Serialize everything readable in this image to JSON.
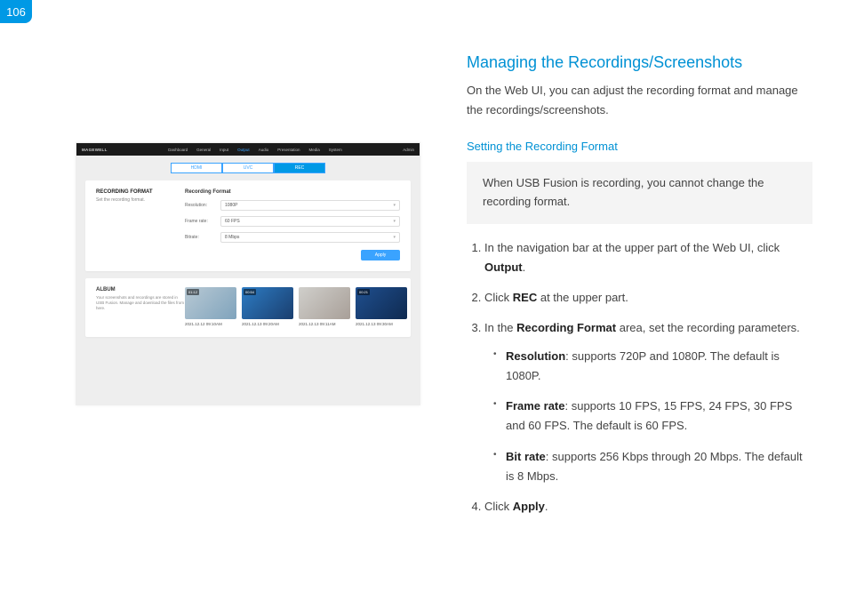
{
  "page_number": "106",
  "heading": "Managing the Recordings/Screenshots",
  "intro": "On the Web UI, you can adjust the recording format and manage the recordings/screenshots.",
  "subheading": "Setting the Recording Format",
  "note": "When USB Fusion is recording, you cannot change the recording format.",
  "steps": {
    "s1_a": "In the navigation bar at the upper part of the Web UI, click ",
    "s1_b": "Output",
    "s1_c": ".",
    "s2_a": "Click ",
    "s2_b": "REC",
    "s2_c": " at the upper part.",
    "s3_a": "In the ",
    "s3_b": "Recording Format",
    "s3_c": " area, set the recording parameters.",
    "s3_res_b": "Resolution",
    "s3_res_t": ": supports 720P and 1080P. The default is 1080P.",
    "s3_fr_b": "Frame rate",
    "s3_fr_t": ": supports 10 FPS, 15 FPS, 24 FPS, 30 FPS and 60 FPS. The default is 60 FPS.",
    "s3_br_b": "Bit rate",
    "s3_br_t": ": supports 256 Kbps through 20 Mbps. The default is 8 Mbps.",
    "s4_a": "Click ",
    "s4_b": "Apply",
    "s4_c": "."
  },
  "shot": {
    "brand": "MAGEWELL",
    "nav": [
      "Dashboard",
      "General",
      "Input",
      "Output",
      "Audio",
      "Presentation",
      "Media",
      "System"
    ],
    "admin": "Admin",
    "tabs": [
      "HDMI",
      "UVC",
      "REC"
    ],
    "rec_title": "RECORDING FORMAT",
    "rec_sub": "Set the recording format.",
    "rec_heading": "Recording Format",
    "fields": {
      "resolution_label": "Resolution:",
      "resolution_value": "1080P",
      "framerate_label": "Frame rate:",
      "framerate_value": "60 FPS",
      "bitrate_label": "Bitrate:",
      "bitrate_value": "8 Mbps"
    },
    "apply": "Apply",
    "album_title": "ALBUM",
    "album_sub": "Your screenshots and recordings are stored in USB Fusion. Manage and download the files from here.",
    "thumbs": [
      {
        "dur": "01:12",
        "cap": "2021.12.12 09:10AM"
      },
      {
        "dur": "00:54",
        "cap": "2021.12.13 09:20AM"
      },
      {
        "dur": "",
        "cap": "2021.12.13 09:11AM"
      },
      {
        "dur": "00:21",
        "cap": "2021.12.13 09:30AM"
      }
    ]
  }
}
